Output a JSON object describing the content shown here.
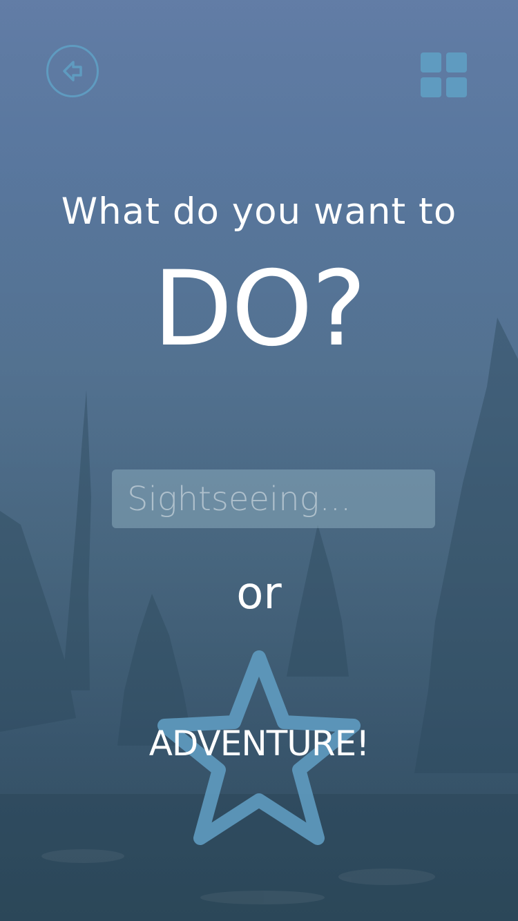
{
  "header": {
    "back_icon": "arrow-left-circle-icon",
    "menu_icon": "grid-icon"
  },
  "prompt": {
    "line1": "What do you want to",
    "line2": "DO?"
  },
  "search": {
    "placeholder": "Sightseeing...",
    "value": ""
  },
  "divider_text": "or",
  "adventure": {
    "label": "ADVENTURE!",
    "icon": "star-outline-icon"
  },
  "colors": {
    "accent": "#5f9bc0",
    "text": "#ffffff",
    "background_top": "#56739f",
    "background_bottom": "#2f4c5e"
  }
}
